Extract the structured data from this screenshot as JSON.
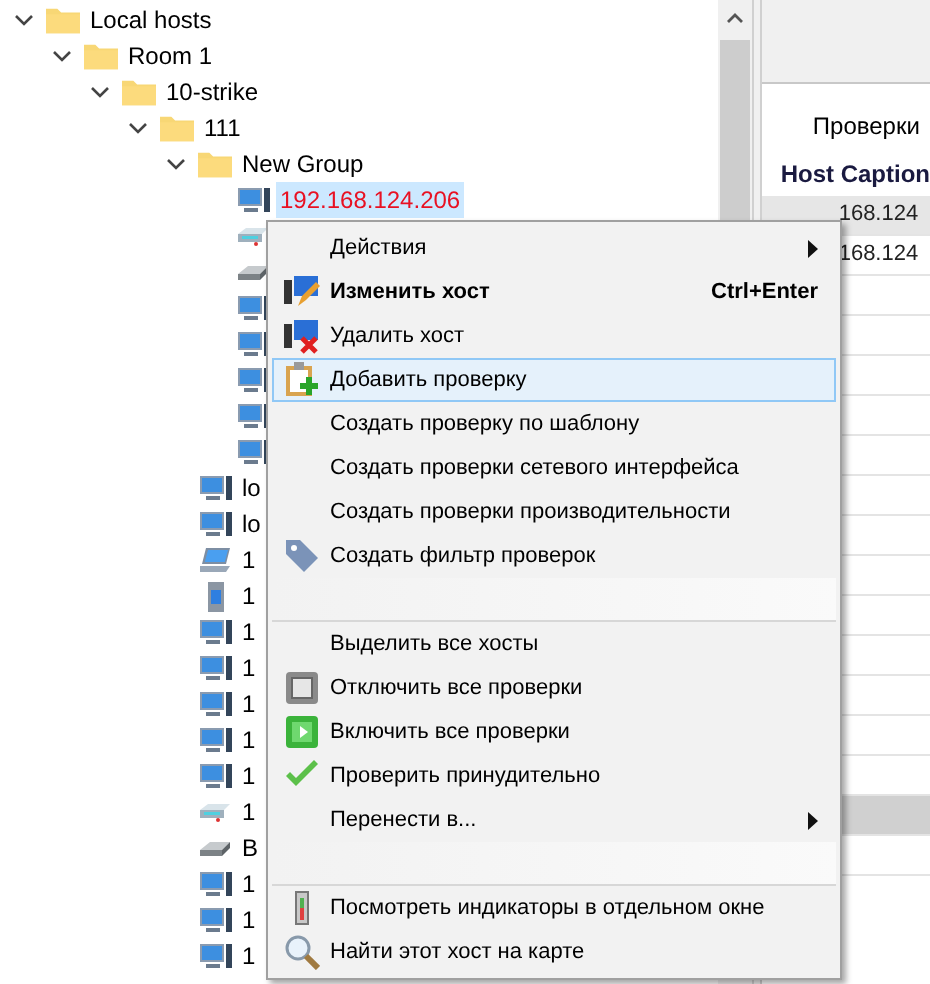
{
  "tree": [
    {
      "label": "Local hosts",
      "expanded": true,
      "children": [
        {
          "label": "Room 1",
          "expanded": true,
          "children": [
            {
              "label": "10-strike",
              "expanded": true,
              "children": [
                {
                  "label": "111",
                  "expanded": true,
                  "children": [
                    {
                      "label": "New Group",
                      "expanded": true,
                      "children": [
                        {
                          "kind": "pc",
                          "label": "192.168.124.206",
                          "selected": true,
                          "down": true
                        },
                        {
                          "kind": "router"
                        },
                        {
                          "kind": "scanner"
                        },
                        {
                          "kind": "pc"
                        },
                        {
                          "kind": "pc"
                        },
                        {
                          "kind": "pc"
                        },
                        {
                          "kind": "pc"
                        },
                        {
                          "kind": "pc"
                        }
                      ]
                    },
                    {
                      "kind": "pc",
                      "label": "lo",
                      "selected": false,
                      "down": false
                    },
                    {
                      "kind": "pc",
                      "label": "lo",
                      "selected": false,
                      "down": false
                    },
                    {
                      "kind": "laptop",
                      "label": "1",
                      "selected": false,
                      "down": false
                    },
                    {
                      "kind": "tower",
                      "label": "1",
                      "selected": false,
                      "down": false
                    },
                    {
                      "kind": "pc",
                      "label": "1",
                      "selected": false,
                      "down": false
                    },
                    {
                      "kind": "pc",
                      "label": "1",
                      "selected": false,
                      "down": false
                    },
                    {
                      "kind": "pc",
                      "label": "1",
                      "selected": false,
                      "down": false
                    },
                    {
                      "kind": "pc",
                      "label": "1",
                      "selected": false,
                      "down": false
                    },
                    {
                      "kind": "pc",
                      "label": "1",
                      "selected": false,
                      "down": false
                    },
                    {
                      "kind": "router",
                      "label": "1",
                      "selected": false,
                      "down": false
                    },
                    {
                      "kind": "scanner",
                      "label": "B",
                      "selected": false,
                      "down": false
                    },
                    {
                      "kind": "pc",
                      "label": "1",
                      "selected": false,
                      "down": false
                    },
                    {
                      "kind": "pc",
                      "label": "1",
                      "selected": false,
                      "down": false
                    },
                    {
                      "kind": "pc",
                      "label": "1",
                      "selected": false,
                      "down": false
                    }
                  ]
                }
              ]
            }
          ]
        }
      ]
    }
  ],
  "checks_panel": {
    "tab": "Проверки",
    "column": "Host Caption",
    "rows": [
      {
        "host_caption": "168.124",
        "selected": true
      },
      {
        "host_caption": "168.124",
        "selected": false
      }
    ]
  },
  "context_menu": [
    {
      "kind": "item",
      "label": "Действия",
      "bold": false,
      "submenu": true,
      "selected": false
    },
    {
      "kind": "item",
      "label": "Изменить хост",
      "bold": true,
      "shortcut": "Ctrl+Enter",
      "submenu": false,
      "selected": false
    },
    {
      "kind": "item",
      "label": "Удалить хост",
      "bold": false,
      "submenu": false,
      "selected": false
    },
    {
      "kind": "item",
      "label": "Добавить проверку",
      "bold": false,
      "submenu": false,
      "selected": true
    },
    {
      "kind": "item",
      "label": "Создать проверку по шаблону",
      "bold": false,
      "submenu": false,
      "selected": false
    },
    {
      "kind": "item",
      "label": "Создать проверки сетевого интерфейса",
      "bold": false,
      "submenu": false,
      "selected": false
    },
    {
      "kind": "item",
      "label": "Создать проверки производительности",
      "bold": false,
      "submenu": false,
      "selected": false
    },
    {
      "kind": "item",
      "label": "Создать фильтр проверок",
      "bold": false,
      "submenu": false,
      "selected": false
    },
    {
      "kind": "separator"
    },
    {
      "kind": "item",
      "label": "Выделить все хосты",
      "bold": false,
      "submenu": false,
      "selected": false
    },
    {
      "kind": "item",
      "label": "Отключить все проверки",
      "bold": false,
      "submenu": false,
      "selected": false
    },
    {
      "kind": "item",
      "label": "Включить все проверки",
      "bold": false,
      "submenu": false,
      "selected": false
    },
    {
      "kind": "item",
      "label": "Проверить принудительно",
      "bold": false,
      "submenu": false,
      "selected": false
    },
    {
      "kind": "item",
      "label": "Перенести в...",
      "bold": false,
      "submenu": true,
      "selected": false
    },
    {
      "kind": "separator"
    },
    {
      "kind": "item",
      "label": "Посмотреть индикаторы в отдельном окне",
      "bold": false,
      "submenu": false,
      "selected": false
    },
    {
      "kind": "item",
      "label": "Найти этот хост на карте",
      "bold": false,
      "submenu": false,
      "selected": false
    }
  ]
}
